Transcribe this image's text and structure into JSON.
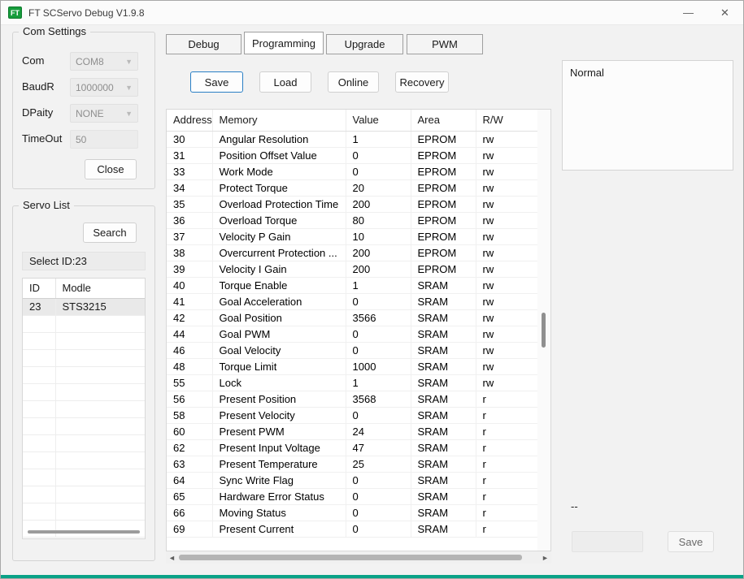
{
  "window": {
    "title": "FT SCServo Debug V1.9.8",
    "icon_text": "FT",
    "minimize_glyph": "—",
    "close_glyph": "✕"
  },
  "com_settings": {
    "title": "Com Settings",
    "fields": [
      {
        "label": "Com",
        "value": "COM8"
      },
      {
        "label": "BaudR",
        "value": "1000000"
      },
      {
        "label": "DPaity",
        "value": "NONE"
      },
      {
        "label": "TimeOut",
        "value": "50"
      }
    ],
    "close_label": "Close"
  },
  "servo_list": {
    "title": "Servo List",
    "search_label": "Search",
    "select_id_label": "Select ID:23",
    "columns": [
      "ID",
      "Modle"
    ],
    "rows": [
      [
        "23",
        "STS3215"
      ]
    ]
  },
  "tabs": [
    {
      "label": "Debug",
      "active": false
    },
    {
      "label": "Programming",
      "active": true
    },
    {
      "label": "Upgrade",
      "active": false
    },
    {
      "label": "PWM",
      "active": false
    }
  ],
  "toolbar": {
    "save_label": "Save",
    "load_label": "Load",
    "online_label": "Online",
    "recovery_label": "Recovery"
  },
  "memory_table": {
    "columns": [
      "Address",
      "Memory",
      "Value",
      "Area",
      "R/W"
    ],
    "rows": [
      [
        "30",
        "Angular Resolution",
        "1",
        "EPROM",
        "rw"
      ],
      [
        "31",
        "Position Offset Value",
        "0",
        "EPROM",
        "rw"
      ],
      [
        "33",
        "Work Mode",
        "0",
        "EPROM",
        "rw"
      ],
      [
        "34",
        "Protect Torque",
        "20",
        "EPROM",
        "rw"
      ],
      [
        "35",
        "Overload Protection Time",
        "200",
        "EPROM",
        "rw"
      ],
      [
        "36",
        "Overload Torque",
        "80",
        "EPROM",
        "rw"
      ],
      [
        "37",
        "Velocity P Gain",
        "10",
        "EPROM",
        "rw"
      ],
      [
        "38",
        "Overcurrent Protection ...",
        "200",
        "EPROM",
        "rw"
      ],
      [
        "39",
        "Velocity I Gain",
        "200",
        "EPROM",
        "rw"
      ],
      [
        "40",
        "Torque Enable",
        "1",
        "SRAM",
        "rw"
      ],
      [
        "41",
        "Goal Acceleration",
        "0",
        "SRAM",
        "rw"
      ],
      [
        "42",
        "Goal Position",
        "3566",
        "SRAM",
        "rw"
      ],
      [
        "44",
        "Goal PWM",
        "0",
        "SRAM",
        "rw"
      ],
      [
        "46",
        "Goal Velocity",
        "0",
        "SRAM",
        "rw"
      ],
      [
        "48",
        "Torque Limit",
        "1000",
        "SRAM",
        "rw"
      ],
      [
        "55",
        "Lock",
        "1",
        "SRAM",
        "rw"
      ],
      [
        "56",
        "Present Position",
        "3568",
        "SRAM",
        "r"
      ],
      [
        "58",
        "Present Velocity",
        "0",
        "SRAM",
        "r"
      ],
      [
        "60",
        "Present PWM",
        "24",
        "SRAM",
        "r"
      ],
      [
        "62",
        "Present Input Voltage",
        "47",
        "SRAM",
        "r"
      ],
      [
        "63",
        "Present Temperature",
        "25",
        "SRAM",
        "r"
      ],
      [
        "64",
        "Sync Write Flag",
        "0",
        "SRAM",
        "r"
      ],
      [
        "65",
        "Hardware Error Status",
        "0",
        "SRAM",
        "r"
      ],
      [
        "66",
        "Moving Status",
        "0",
        "SRAM",
        "r"
      ],
      [
        "69",
        "Present Current",
        "0",
        "SRAM",
        "r"
      ]
    ]
  },
  "status_panel": {
    "text": "Normal"
  },
  "bottom_bar": {
    "dashes": "--",
    "input_value": "",
    "save_label": "Save"
  }
}
